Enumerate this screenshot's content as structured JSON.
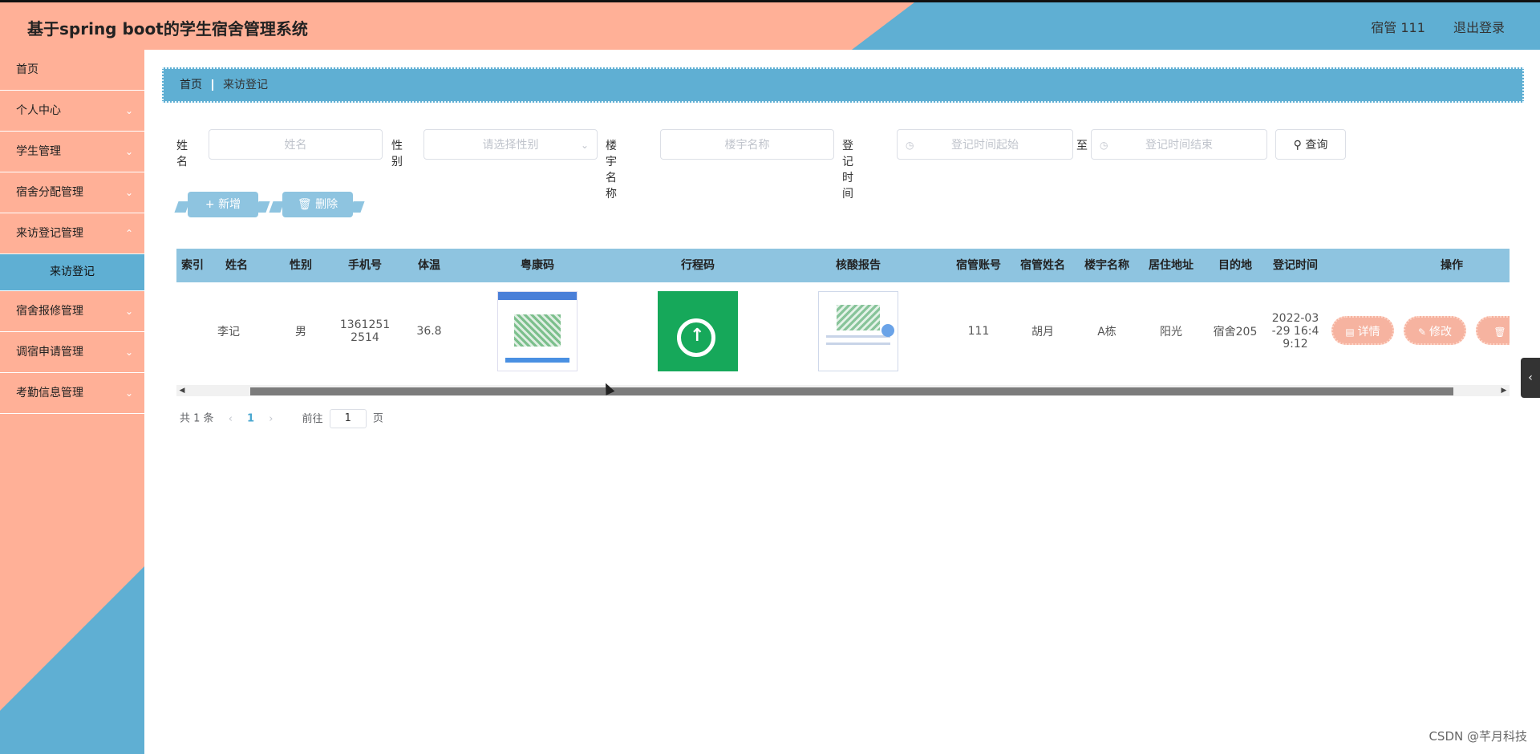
{
  "header": {
    "title": "基于spring boot的学生宿舍管理系统",
    "user": "宿管 111",
    "logout": "退出登录"
  },
  "sidebar": {
    "items": [
      {
        "label": "首页"
      },
      {
        "label": "个人中心"
      },
      {
        "label": "学生管理"
      },
      {
        "label": "宿舍分配管理"
      },
      {
        "label": "来访登记管理"
      },
      {
        "label": "来访登记"
      },
      {
        "label": "宿舍报修管理"
      },
      {
        "label": "调宿申请管理"
      },
      {
        "label": "考勤信息管理"
      }
    ]
  },
  "breadcrumb": {
    "home": "首页",
    "current": "来访登记"
  },
  "search": {
    "name_label": "姓名",
    "name_placeholder": "姓名",
    "gender_label": "性别",
    "gender_placeholder": "请选择性别",
    "building_label": "楼宇名称",
    "building_placeholder": "楼宇名称",
    "time_label": "登记时间",
    "time_start_placeholder": "登记时间起始",
    "to_label": "至",
    "time_end_placeholder": "登记时间结束",
    "query_button": "查询"
  },
  "actions": {
    "add": "新增",
    "delete": "删除"
  },
  "table": {
    "headers": [
      "索引",
      "姓名",
      "性别",
      "手机号",
      "体温",
      "粤康码",
      "行程码",
      "核酸报告",
      "宿管账号",
      "宿管姓名",
      "楼宇名称",
      "居住地址",
      "目的地",
      "登记时间",
      "操作"
    ],
    "rows": [
      {
        "name": "李记",
        "gender": "男",
        "phone_line1": "1361251",
        "phone_line2": "2514",
        "temp": "36.8",
        "manager_account": "111",
        "manager_name": "胡月",
        "building": "A栋",
        "address": "阳光",
        "destination": "宿舍205",
        "time_line1": "2022-03",
        "time_line2": "-29 16:4",
        "time_line3": "9:12"
      }
    ],
    "op_detail": "详情",
    "op_edit": "修改",
    "op_delete": "删"
  },
  "pager": {
    "total": "共 1 条",
    "current": "1",
    "goto": "前往",
    "goto_value": "1",
    "page_unit": "页"
  },
  "watermark": "CSDN @芊月科技"
}
